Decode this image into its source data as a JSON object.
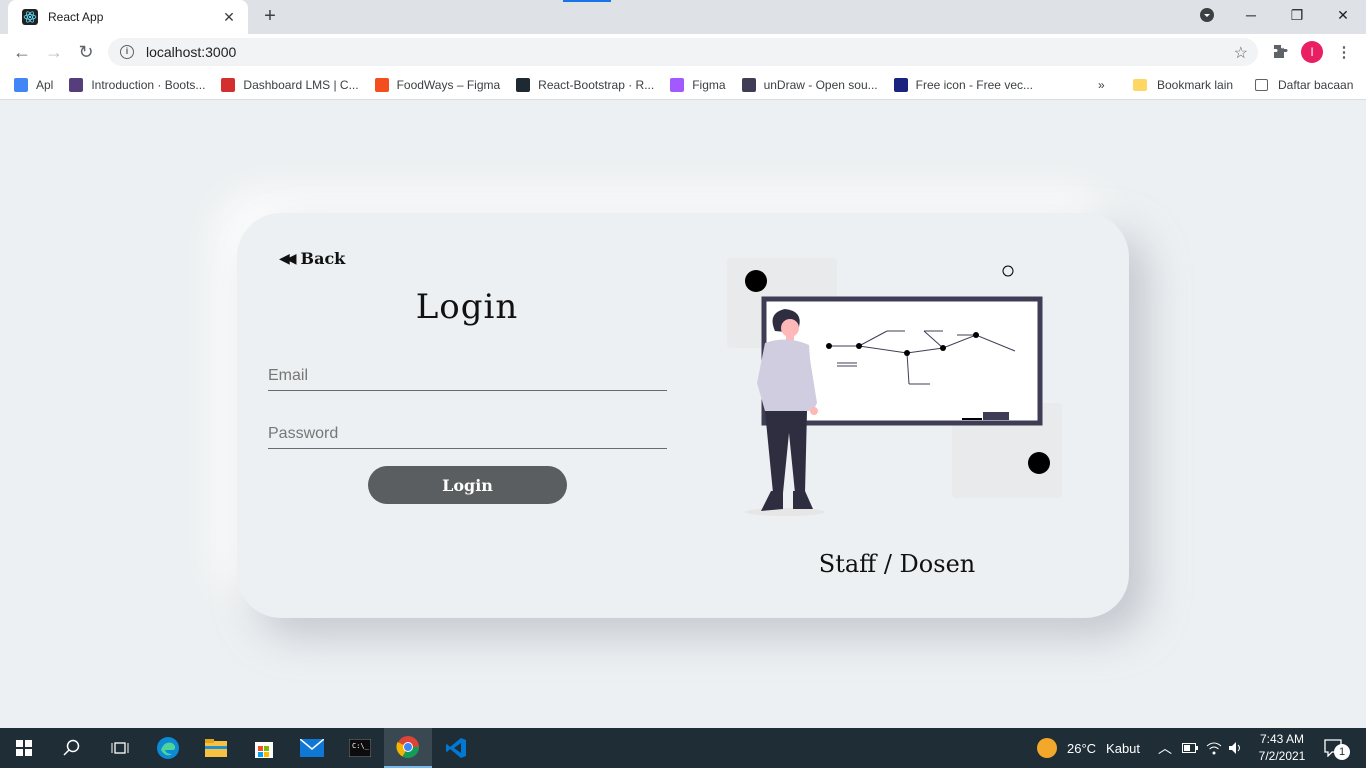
{
  "browser": {
    "tab_title": "React App",
    "url": "localhost:3000",
    "profile_initial": "I",
    "bookmarks": [
      {
        "label": "Apl",
        "icon": "apps-grid-icon",
        "color": "#4285f4"
      },
      {
        "label": "Introduction · Boots...",
        "icon": "bootstrap-icon",
        "color": "#563d7c"
      },
      {
        "label": "Dashboard LMS | C...",
        "icon": "dashboard-icon",
        "color": "#d32f2f"
      },
      {
        "label": "FoodWays – Figma",
        "icon": "figma-icon",
        "color": "#f24e1e"
      },
      {
        "label": "React-Bootstrap · R...",
        "icon": "react-bootstrap-icon",
        "color": "#1e2a33"
      },
      {
        "label": "Figma",
        "icon": "figma-icon",
        "color": "#a259ff"
      },
      {
        "label": "unDraw - Open sou...",
        "icon": "undraw-icon",
        "color": "#3f3d56"
      },
      {
        "label": "Free icon - Free vec...",
        "icon": "freepik-icon",
        "color": "#1a237e"
      }
    ],
    "bookmark_overflow": "»",
    "other_bookmarks": "Bookmark lain",
    "reading_list": "Daftar bacaan"
  },
  "login_page": {
    "back_label": "Back",
    "title": "Login",
    "email_placeholder": "Email",
    "password_placeholder": "Password",
    "login_button": "Login",
    "role_label": "Staff / Dosen"
  },
  "taskbar": {
    "weather_temp": "26°C",
    "weather_desc": "Kabut",
    "time": "7:43 AM",
    "date": "7/2/2021",
    "notification_count": "1"
  },
  "colors": {
    "page_bg": "#edf0f2",
    "button_bg": "#5b5e60",
    "board_frame": "#3f3d56",
    "taskbar_bg": "#1f2d36"
  }
}
